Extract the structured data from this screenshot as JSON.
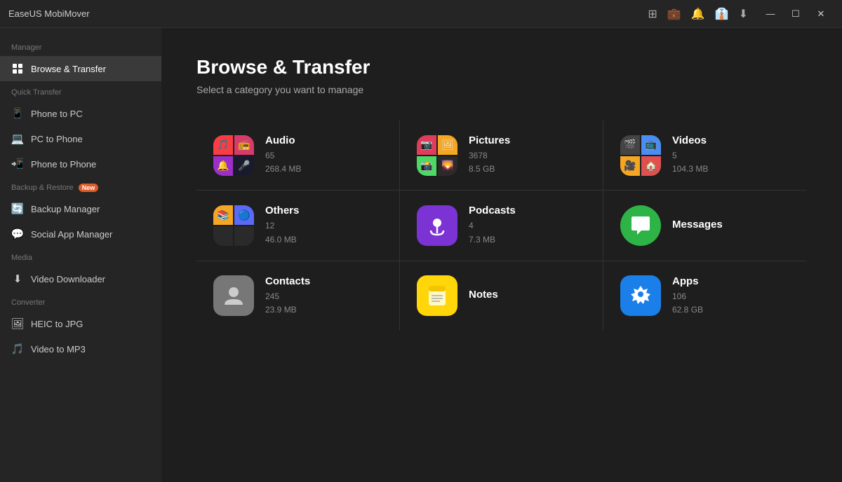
{
  "app": {
    "title": "EaseUS MobiMover"
  },
  "titlebar": {
    "icons": [
      "device-icon",
      "briefcase-icon",
      "bell-icon",
      "shirt-icon",
      "dropdown-icon"
    ],
    "controls": [
      "minimize",
      "maximize",
      "close"
    ]
  },
  "sidebar": {
    "sections": [
      {
        "label": "Manager",
        "items": [
          {
            "id": "browse-transfer",
            "label": "Browse & Transfer",
            "icon": "grid",
            "active": true
          }
        ]
      },
      {
        "label": "Quick Transfer",
        "items": [
          {
            "id": "phone-to-pc",
            "label": "Phone to PC",
            "icon": "phone-pc"
          },
          {
            "id": "pc-to-phone",
            "label": "PC to Phone",
            "icon": "pc-phone"
          },
          {
            "id": "phone-to-phone",
            "label": "Phone to Phone",
            "icon": "phone-phone"
          }
        ]
      },
      {
        "label": "Backup & Restore",
        "badge": "New",
        "items": [
          {
            "id": "backup-manager",
            "label": "Backup Manager",
            "icon": "backup"
          },
          {
            "id": "social-app-manager",
            "label": "Social App Manager",
            "icon": "social"
          }
        ]
      },
      {
        "label": "Media",
        "items": [
          {
            "id": "video-downloader",
            "label": "Video Downloader",
            "icon": "video-dl"
          }
        ]
      },
      {
        "label": "Converter",
        "items": [
          {
            "id": "heic-jpg",
            "label": "HEIC to JPG",
            "icon": "heic"
          },
          {
            "id": "video-mp3",
            "label": "Video to MP3",
            "icon": "video-mp3"
          }
        ]
      }
    ]
  },
  "content": {
    "title": "Browse & Transfer",
    "subtitle": "Select a category you want to manage",
    "categories": [
      {
        "id": "audio",
        "name": "Audio",
        "count": "65",
        "size": "268.4 MB",
        "iconType": "grid",
        "iconBg": "#1c1c1e"
      },
      {
        "id": "pictures",
        "name": "Pictures",
        "count": "3678",
        "size": "8.5 GB",
        "iconType": "grid-pic",
        "iconBg": "#1c1c1e"
      },
      {
        "id": "videos",
        "name": "Videos",
        "count": "5",
        "size": "104.3 MB",
        "iconType": "grid-vid",
        "iconBg": "#1c1c1e"
      },
      {
        "id": "others",
        "name": "Others",
        "count": "12",
        "size": "46.0 MB",
        "iconType": "others",
        "iconBg": "#2a2a2a"
      },
      {
        "id": "podcasts",
        "name": "Podcasts",
        "count": "4",
        "size": "7.3 MB",
        "iconType": "podcasts",
        "iconBg": "#7b33d4"
      },
      {
        "id": "messages",
        "name": "Messages",
        "count": "",
        "size": "",
        "iconType": "messages",
        "iconBg": "#2eb347"
      },
      {
        "id": "contacts",
        "name": "Contacts",
        "count": "245",
        "size": "23.9 MB",
        "iconType": "contacts",
        "iconBg": "#666"
      },
      {
        "id": "notes",
        "name": "Notes",
        "count": "",
        "size": "",
        "iconType": "notes",
        "iconBg": "#ffd60a"
      },
      {
        "id": "apps",
        "name": "Apps",
        "count": "106",
        "size": "62.8 GB",
        "iconType": "apps",
        "iconBg": "#1a7fe8"
      }
    ]
  }
}
